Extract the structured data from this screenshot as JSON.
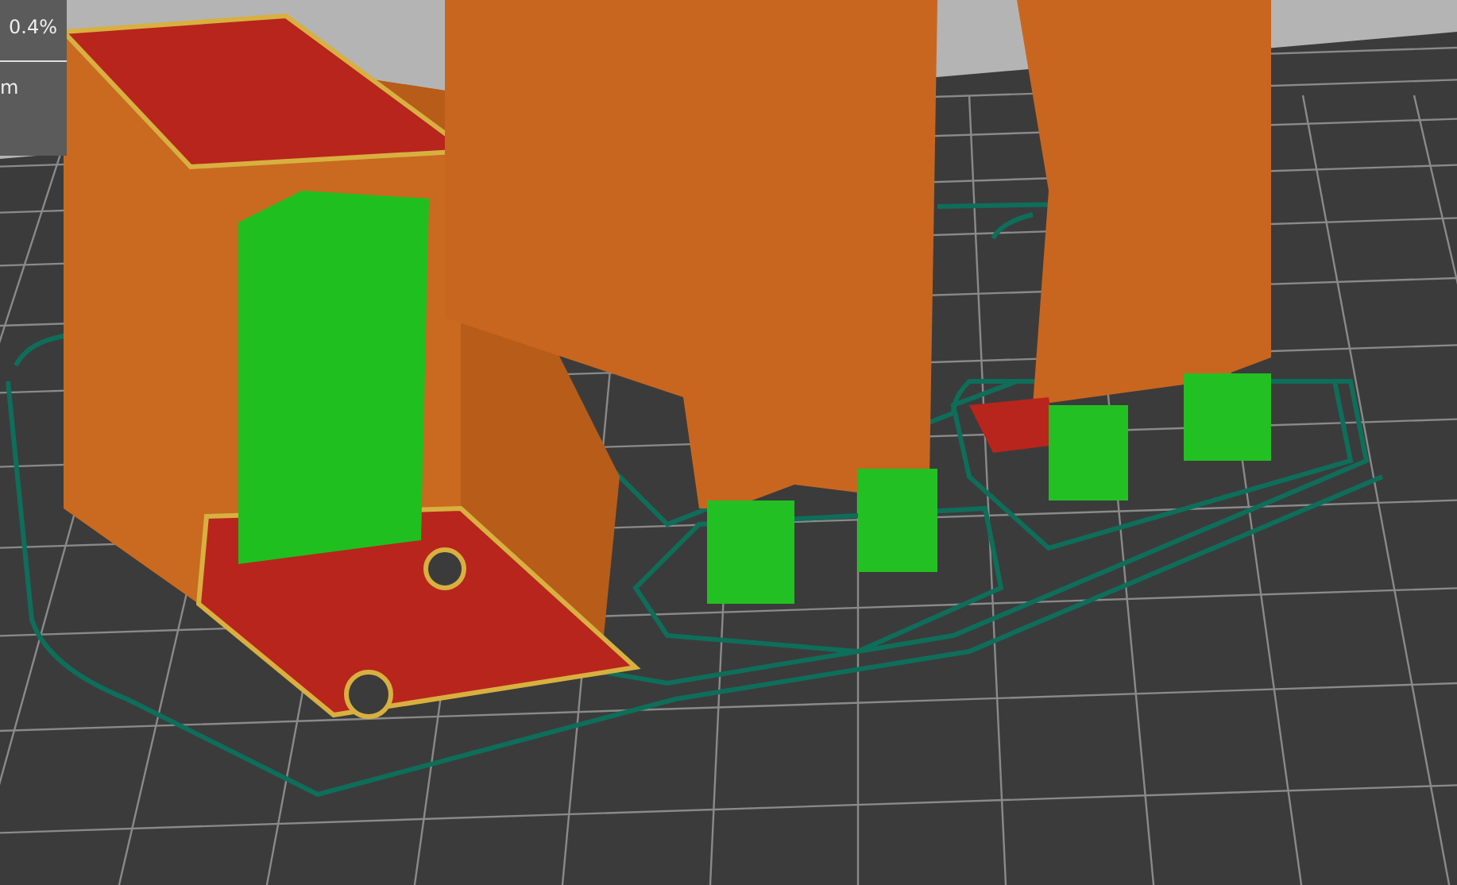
{
  "legend": {
    "value": "0.4%",
    "label": "m"
  }
}
